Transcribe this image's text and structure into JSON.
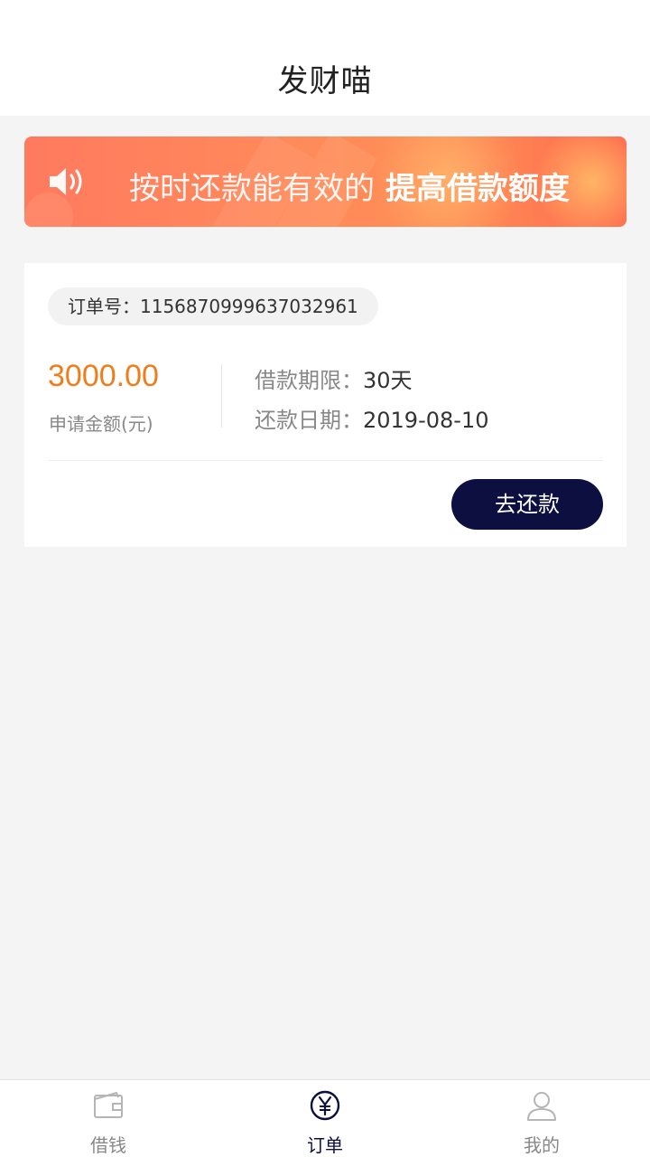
{
  "header": {
    "title": "发财喵"
  },
  "banner": {
    "text": "按时还款能有效的",
    "highlight": "提高借款额度",
    "icon": "speaker-icon"
  },
  "order": {
    "number_label": "订单号：",
    "number": "1156870999637032961",
    "amount": "3000.00",
    "amount_label": "申请金额(元)",
    "term_label": "借款期限：",
    "term_value": "30天",
    "date_label": "还款日期：",
    "date_value": "2019-08-10",
    "repay_button": "去还款"
  },
  "tabs": [
    {
      "label": "借钱",
      "icon": "wallet-icon",
      "active": false
    },
    {
      "label": "订单",
      "icon": "yen-circle-icon",
      "active": true
    },
    {
      "label": "我的",
      "icon": "person-icon",
      "active": false
    }
  ],
  "colors": {
    "accent": "#0d0f40",
    "amount": "#f07d1b",
    "banner_start": "#ff7a5f",
    "banner_end": "#ff6a4f"
  }
}
